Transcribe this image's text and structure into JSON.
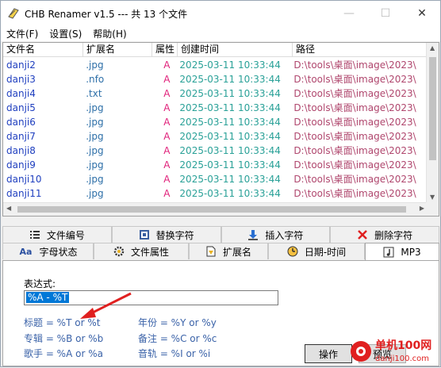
{
  "window": {
    "title": "CHB Renamer v1.5 --- 共 13 个文件",
    "minimize_glyph": "—",
    "maximize_glyph": "☐",
    "close_glyph": "✕"
  },
  "menu": [
    "文件(F)",
    "设置(S)",
    "帮助(H)"
  ],
  "list": {
    "columns": [
      "文件名",
      "扩展名",
      "属性",
      "创建时间",
      "路径"
    ],
    "rows": [
      [
        "danji2",
        ".jpg",
        "A",
        "2025-03-11 10:33:44",
        "D:\\tools\\桌面\\image\\2023\\"
      ],
      [
        "danji3",
        ".nfo",
        "A",
        "2025-03-11 10:33:44",
        "D:\\tools\\桌面\\image\\2023\\"
      ],
      [
        "danji4",
        ".txt",
        "A",
        "2025-03-11 10:33:44",
        "D:\\tools\\桌面\\image\\2023\\"
      ],
      [
        "danji5",
        ".jpg",
        "A",
        "2025-03-11 10:33:44",
        "D:\\tools\\桌面\\image\\2023\\"
      ],
      [
        "danji6",
        ".jpg",
        "A",
        "2025-03-11 10:33:44",
        "D:\\tools\\桌面\\image\\2023\\"
      ],
      [
        "danji7",
        ".jpg",
        "A",
        "2025-03-11 10:33:44",
        "D:\\tools\\桌面\\image\\2023\\"
      ],
      [
        "danji8",
        ".jpg",
        "A",
        "2025-03-11 10:33:44",
        "D:\\tools\\桌面\\image\\2023\\"
      ],
      [
        "danji9",
        ".jpg",
        "A",
        "2025-03-11 10:33:44",
        "D:\\tools\\桌面\\image\\2023\\"
      ],
      [
        "danji10",
        ".jpg",
        "A",
        "2025-03-11 10:33:44",
        "D:\\tools\\桌面\\image\\2023\\"
      ],
      [
        "danji11",
        ".jpg",
        "A",
        "2025-03-11 10:33:44",
        "D:\\tools\\桌面\\image\\2023\\"
      ]
    ]
  },
  "tabs_row1": [
    {
      "label": "文件编号",
      "icon": "list-numbered-icon"
    },
    {
      "label": "替换字符",
      "icon": "replace-icon"
    },
    {
      "label": "插入字符",
      "icon": "insert-icon"
    },
    {
      "label": "删除字符",
      "icon": "delete-x-icon"
    }
  ],
  "tabs_row2": [
    {
      "label": "字母状态",
      "icon": "letter-case-icon"
    },
    {
      "label": "文件属性",
      "icon": "gear-icon"
    },
    {
      "label": "扩展名",
      "icon": "extension-icon"
    },
    {
      "label": "日期-时间",
      "icon": "clock-icon"
    },
    {
      "label": "MP3",
      "icon": "music-note-icon",
      "active": true
    }
  ],
  "panel": {
    "expr_label": "表达式:",
    "expr_value": "%A - %T",
    "hints_left": [
      "标题 = %T or %t",
      "专辑 = %B or %b",
      "歌手 = %A or %a"
    ],
    "hints_right": [
      "年份 = %Y or %y",
      "备注 = %C or %c",
      "音轨 = %I or %i"
    ],
    "ok_label": "操作",
    "cancel_label": "预览"
  },
  "watermark": {
    "text": "单机100网",
    "subtext": "danji100.com"
  },
  "colors": {
    "filename": "#1f3fbf",
    "extension": "#2d6fa8",
    "attribute": "#e0207a",
    "created": "#2aa198",
    "path": "#b0476e",
    "selection": "#0078d7",
    "arrow": "#e02020"
  }
}
